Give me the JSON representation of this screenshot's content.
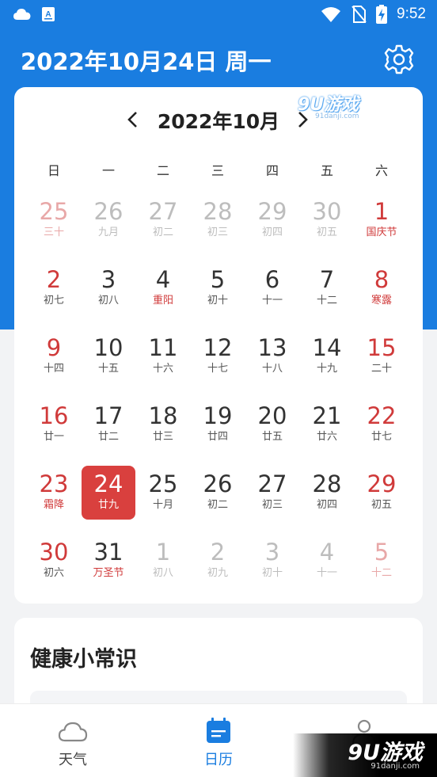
{
  "status_bar": {
    "time": "9:52"
  },
  "header": {
    "title": "2022年10月24日 周一"
  },
  "calendar": {
    "month_title": "2022年10月",
    "prev_symbol": "<",
    "next_symbol": ">",
    "weekdays": [
      "日",
      "一",
      "二",
      "三",
      "四",
      "五",
      "六"
    ],
    "days": [
      {
        "num": "25",
        "sub": "三十",
        "state": "other",
        "weekend": true
      },
      {
        "num": "26",
        "sub": "九月",
        "state": "other",
        "weekend": false
      },
      {
        "num": "27",
        "sub": "初二",
        "state": "other",
        "weekend": false
      },
      {
        "num": "28",
        "sub": "初三",
        "state": "other",
        "weekend": false
      },
      {
        "num": "29",
        "sub": "初四",
        "state": "other",
        "weekend": false
      },
      {
        "num": "30",
        "sub": "初五",
        "state": "other",
        "weekend": false
      },
      {
        "num": "1",
        "sub": "国庆节",
        "state": "current",
        "weekend": true,
        "festival": true
      },
      {
        "num": "2",
        "sub": "初七",
        "state": "current",
        "weekend": true
      },
      {
        "num": "3",
        "sub": "初八",
        "state": "current",
        "weekend": false
      },
      {
        "num": "4",
        "sub": "重阳",
        "state": "current",
        "weekend": false,
        "festival": true
      },
      {
        "num": "5",
        "sub": "初十",
        "state": "current",
        "weekend": false
      },
      {
        "num": "6",
        "sub": "十一",
        "state": "current",
        "weekend": false
      },
      {
        "num": "7",
        "sub": "十二",
        "state": "current",
        "weekend": false
      },
      {
        "num": "8",
        "sub": "寒露",
        "state": "current",
        "weekend": true,
        "festival": true
      },
      {
        "num": "9",
        "sub": "十四",
        "state": "current",
        "weekend": true
      },
      {
        "num": "10",
        "sub": "十五",
        "state": "current",
        "weekend": false
      },
      {
        "num": "11",
        "sub": "十六",
        "state": "current",
        "weekend": false
      },
      {
        "num": "12",
        "sub": "十七",
        "state": "current",
        "weekend": false
      },
      {
        "num": "13",
        "sub": "十八",
        "state": "current",
        "weekend": false
      },
      {
        "num": "14",
        "sub": "十九",
        "state": "current",
        "weekend": false
      },
      {
        "num": "15",
        "sub": "二十",
        "state": "current",
        "weekend": true
      },
      {
        "num": "16",
        "sub": "廿一",
        "state": "current",
        "weekend": true
      },
      {
        "num": "17",
        "sub": "廿二",
        "state": "current",
        "weekend": false
      },
      {
        "num": "18",
        "sub": "廿三",
        "state": "current",
        "weekend": false
      },
      {
        "num": "19",
        "sub": "廿四",
        "state": "current",
        "weekend": false
      },
      {
        "num": "20",
        "sub": "廿五",
        "state": "current",
        "weekend": false
      },
      {
        "num": "21",
        "sub": "廿六",
        "state": "current",
        "weekend": false
      },
      {
        "num": "22",
        "sub": "廿七",
        "state": "current",
        "weekend": true
      },
      {
        "num": "23",
        "sub": "霜降",
        "state": "current",
        "weekend": true,
        "festival": true
      },
      {
        "num": "24",
        "sub": "廿九",
        "state": "selected",
        "weekend": false
      },
      {
        "num": "25",
        "sub": "十月",
        "state": "current",
        "weekend": false
      },
      {
        "num": "26",
        "sub": "初二",
        "state": "current",
        "weekend": false
      },
      {
        "num": "27",
        "sub": "初三",
        "state": "current",
        "weekend": false
      },
      {
        "num": "28",
        "sub": "初四",
        "state": "current",
        "weekend": false
      },
      {
        "num": "29",
        "sub": "初五",
        "state": "current",
        "weekend": true
      },
      {
        "num": "30",
        "sub": "初六",
        "state": "current",
        "weekend": true
      },
      {
        "num": "31",
        "sub": "万圣节",
        "state": "current",
        "weekend": false,
        "festival": true
      },
      {
        "num": "1",
        "sub": "初八",
        "state": "other",
        "weekend": false
      },
      {
        "num": "2",
        "sub": "初九",
        "state": "other",
        "weekend": false
      },
      {
        "num": "3",
        "sub": "初十",
        "state": "other",
        "weekend": false
      },
      {
        "num": "4",
        "sub": "十一",
        "state": "other",
        "weekend": false
      },
      {
        "num": "5",
        "sub": "十二",
        "state": "other",
        "weekend": true
      }
    ]
  },
  "health": {
    "title": "健康小常识"
  },
  "bottom_nav": {
    "items": [
      {
        "label": "天气",
        "icon": "cloud-icon",
        "active": false
      },
      {
        "label": "日历",
        "icon": "calendar-icon",
        "active": true
      },
      {
        "label": "",
        "icon": "user-icon",
        "active": false
      }
    ]
  },
  "watermarks": {
    "top_logo": "9U游戏",
    "top_sub": "91danji.com",
    "bottom_logo": "9U游戏",
    "bottom_sub": "91danji.com"
  },
  "colors": {
    "brand_blue": "#1a7de0",
    "weekend_red": "#d03a3a",
    "selected_bg": "#d9403e",
    "text_dark": "#333333",
    "text_grey": "#bdbdbd",
    "weekend_faded": "#e8a8a8"
  }
}
